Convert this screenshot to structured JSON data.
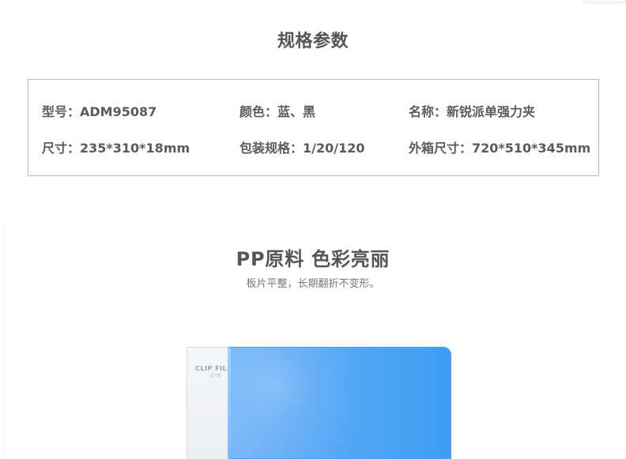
{
  "specifications": {
    "title": "规格参数",
    "items": [
      {
        "label": "型号：",
        "value": "ADM95087"
      },
      {
        "label": "颜色：",
        "value": "蓝、黑"
      },
      {
        "label": "名称：",
        "value": "新锐派单强力夹"
      },
      {
        "label": "尺寸：",
        "value": "235*310*18mm"
      },
      {
        "label": "包装规格：",
        "value": "1/20/120"
      },
      {
        "label": "外箱尺寸：",
        "value": "720*510*345mm"
      }
    ]
  },
  "material_section": {
    "title": "PP原料  色彩亮丽",
    "subtitle": "板片平整，长期翻折不变形。",
    "product": {
      "spine_text": "CLIP FILE",
      "spine_subtext": "强力夹",
      "cover_color": "#4aa3f4"
    }
  }
}
